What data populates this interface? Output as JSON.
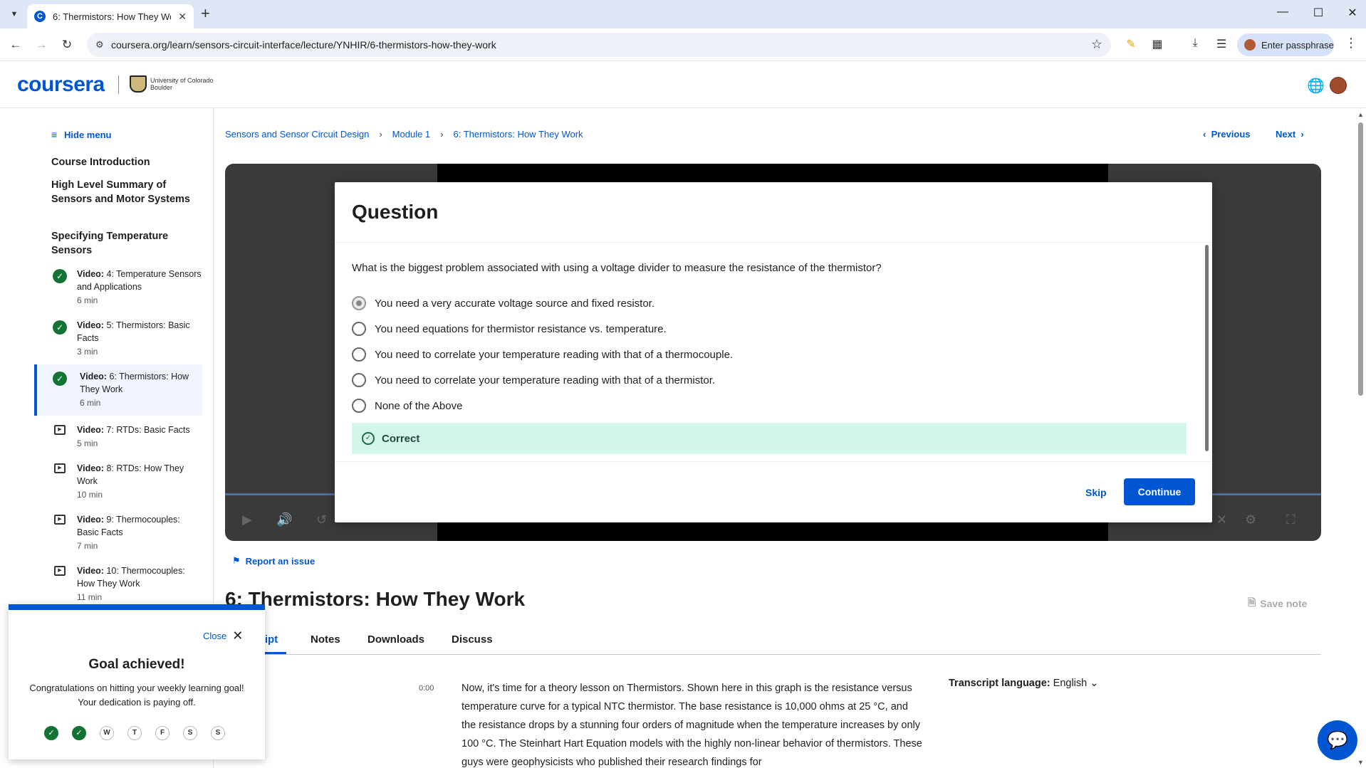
{
  "browser": {
    "tab_title": "6: Thermistors: How They Work",
    "url": "coursera.org/learn/sensors-circuit-interface/lecture/YNHIR/6-thermistors-how-they-work",
    "profile_label": "Enter passphrase"
  },
  "header": {
    "logo": "coursera",
    "partner": "University of Colorado Boulder"
  },
  "sidebar": {
    "hide_menu": "Hide menu",
    "sections": [
      "Course Introduction",
      "High Level Summary of Sensors and Motor Systems",
      "Specifying Temperature Sensors"
    ],
    "lessons": [
      {
        "kind": "Video:",
        "title": "4: Temperature Sensors and Applications",
        "duration": "6 min",
        "status": "completed"
      },
      {
        "kind": "Video:",
        "title": "5: Thermistors: Basic Facts",
        "duration": "3 min",
        "status": "completed"
      },
      {
        "kind": "Video:",
        "title": "6: Thermistors: How They Work",
        "duration": "6 min",
        "status": "completed"
      },
      {
        "kind": "Video:",
        "title": "7: RTDs: Basic Facts",
        "duration": "5 min",
        "status": "not-started"
      },
      {
        "kind": "Video:",
        "title": "8: RTDs: How They Work",
        "duration": "10 min",
        "status": "not-started"
      },
      {
        "kind": "Video:",
        "title": "9: Thermocouples: Basic Facts",
        "duration": "7 min",
        "status": "not-started"
      },
      {
        "kind": "Video:",
        "title": "10: Thermocouples: How They Work",
        "duration": "11 min",
        "status": "not-started"
      }
    ]
  },
  "breadcrumb": [
    "Sensors and Sensor Circuit Design",
    "Module 1",
    "6: Thermistors: How They Work"
  ],
  "nav": {
    "previous": "Previous",
    "next": "Next"
  },
  "quiz": {
    "title": "Question",
    "question": "What is the biggest problem associated with using a voltage divider to measure the resistance of the thermistor?",
    "options": [
      "You need a very accurate voltage source and fixed resistor.",
      "You need equations for thermistor resistance vs. temperature.",
      "You need to correlate your temperature reading with that of a thermocouple.",
      "You need to correlate your temperature reading with that of a thermistor.",
      "None of the Above"
    ],
    "selected_index": 0,
    "feedback": "Correct",
    "skip": "Skip",
    "continue": "Continue"
  },
  "report_issue": "Report an issue",
  "lecture_title": "6: Thermistors: How They Work",
  "save_note": "Save note",
  "tabs": [
    "ript",
    "Notes",
    "Downloads",
    "Discuss"
  ],
  "transcript": {
    "timestamp": "0:00",
    "text": "Now, it's time for a theory lesson on Thermistors. Shown here in this graph is the resistance versus temperature curve for a typical NTC thermistor. The base resistance is 10,000 ohms at 25 °C, and the resistance drops by a stunning four orders of magnitude when the temperature increases by only 100 °C. The Steinhart Hart Equation models with the highly non-linear behavior of thermistors. These guys were geophysicists who published their research findings for",
    "language_label": "Transcript language:",
    "language_value": "English"
  },
  "goal_popup": {
    "close": "Close",
    "title": "Goal achieved!",
    "message": "Congratulations on hitting your weekly learning goal! Your dedication is paying off.",
    "days": [
      "✓",
      "✓",
      "W",
      "T",
      "F",
      "S",
      "S"
    ]
  },
  "colors": {
    "brand": "#0056d2",
    "success": "#137333",
    "correct_bg": "#d3f6e8"
  }
}
